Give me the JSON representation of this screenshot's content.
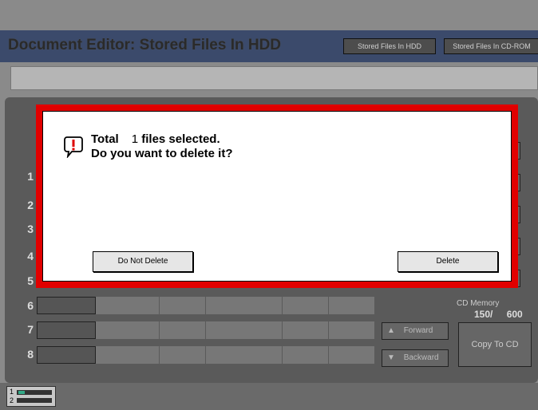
{
  "header": {
    "title": "Document Editor: Stored Files In HDD",
    "tabs": [
      "Stored Files In HDD",
      "Stored Files In CD-ROM"
    ]
  },
  "rows": [
    "1",
    "2",
    "3",
    "4",
    "5",
    "6",
    "7",
    "8"
  ],
  "cd_memory": {
    "label": "CD Memory",
    "used": "150/",
    "total": "600"
  },
  "nav": {
    "forward": "Forward",
    "backward": "Backward",
    "copy": "Copy To CD"
  },
  "footer": {
    "line1": "1",
    "line2": "2"
  },
  "dialog": {
    "line1_prefix": "Total",
    "line1_count": "1",
    "line1_suffix": "files selected.",
    "line2": "Do you want to delete it?",
    "cancel": "Do Not Delete",
    "confirm": "Delete"
  },
  "colors": {
    "header": "#3b4a6b",
    "dialog_border": "#e10000"
  }
}
